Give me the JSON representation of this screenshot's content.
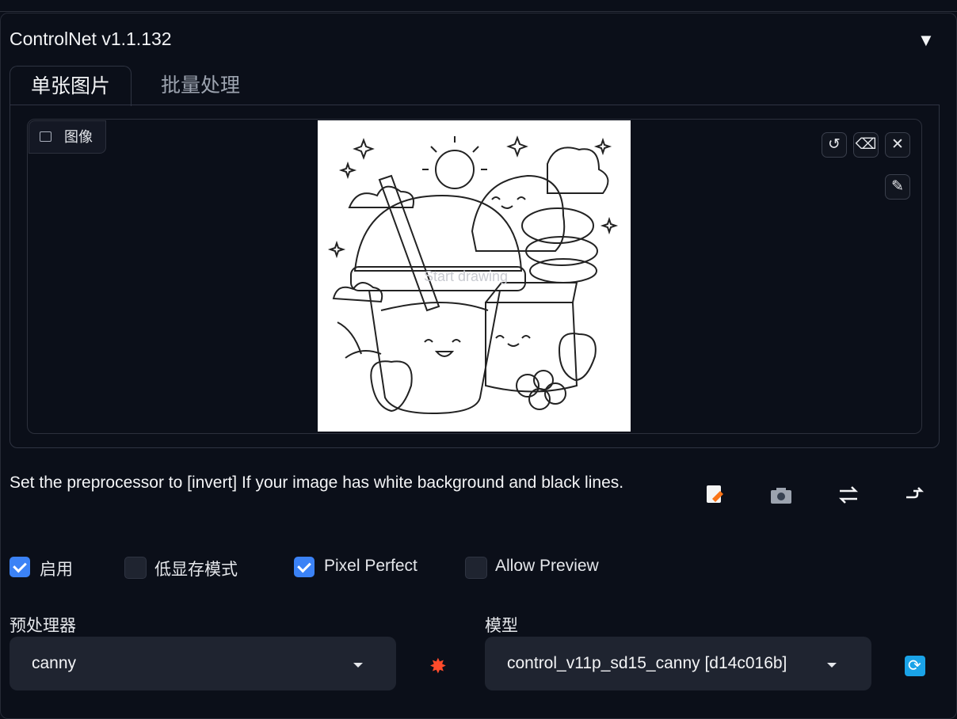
{
  "panel": {
    "title": "ControlNet v1.1.132",
    "collapse_icon": "▼"
  },
  "tabs": [
    {
      "label": "单张图片",
      "active": true
    },
    {
      "label": "批量处理",
      "active": false
    }
  ],
  "image_box": {
    "label": "图像",
    "placeholder": "Start drawing",
    "tools": [
      "undo-icon",
      "eraser-icon",
      "close-icon",
      "brush-icon"
    ]
  },
  "hint_text": "Set the preprocessor to [invert] If your image has white background and black lines.",
  "action_icons": [
    "new-canvas-icon",
    "camera-icon",
    "swap-icon",
    "send-dimensions-icon"
  ],
  "checkboxes": [
    {
      "label": "启用",
      "checked": true
    },
    {
      "label": "低显存模式",
      "checked": false
    },
    {
      "label": "Pixel Perfect",
      "checked": true
    },
    {
      "label": "Allow Preview",
      "checked": false
    }
  ],
  "preprocessor": {
    "label": "预处理器",
    "value": "canny"
  },
  "model": {
    "label": "模型",
    "value": "control_v11p_sd15_canny [d14c016b]"
  },
  "colors": {
    "accent": "#3b82f6",
    "background": "#0b0f19",
    "field": "#1f2430",
    "refresh": "#1aa3e8"
  }
}
